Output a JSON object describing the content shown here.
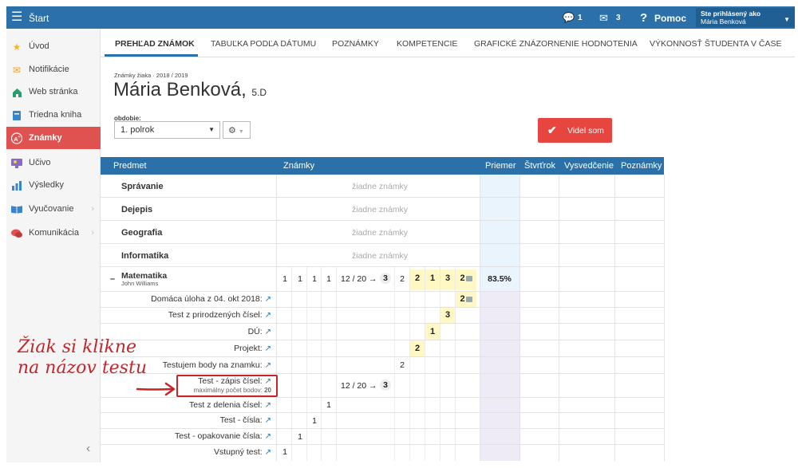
{
  "topbar": {
    "menu_icon": "hamburger-icon",
    "title": "Štart",
    "chat_count": "1",
    "mail_count": "3",
    "help_label": "Pomoc",
    "user_line1": "Ste prihlásený ako",
    "user_line2": "Mária Benková"
  },
  "sidebar": {
    "items": [
      {
        "label": "Úvod",
        "icon": "star-icon",
        "color": "#f2b52a"
      },
      {
        "label": "Notifikácie",
        "icon": "envelope-icon",
        "color": "#f0a030"
      },
      {
        "label": "Web stránka",
        "icon": "home-icon",
        "color": "#2a9d6c"
      },
      {
        "label": "Triedna kniha",
        "icon": "book-icon",
        "color": "#3a85c8"
      },
      {
        "label": "Známky",
        "icon": "grade-icon",
        "color": "#ffffff"
      },
      {
        "label": "Učivo",
        "icon": "lesson-icon",
        "color": "#8a6ac8"
      },
      {
        "label": "Výsledky",
        "icon": "bar-chart-icon",
        "color": "#3a85c8"
      },
      {
        "label": "Vyučovanie",
        "icon": "open-book-icon",
        "color": "#3a85c8"
      },
      {
        "label": "Komunikácia",
        "icon": "chat-icon",
        "color": "#e0524f"
      }
    ]
  },
  "tabs": [
    "PREHĽAD ZNÁMOK",
    "TABUĽKA PODĽA DÁTUMU",
    "POZNÁMKY",
    "KOMPETENCIE",
    "GRAFICKÉ ZNÁZORNENIE HODNOTENIA",
    "VÝKONNOSŤ ŠTUDENTA V ČASE"
  ],
  "header": {
    "subtitle": "Známky žiaka · 2018 / 2019",
    "student_name": "Mária Benková,",
    "student_class": "5.D",
    "period_label": "obdobie:",
    "period_value": "1. polrok",
    "seen_button": "Videl som"
  },
  "grid": {
    "columns": [
      "Predmet",
      "Známky",
      "Priemer",
      "Štvrťrok",
      "Vysvedčenie",
      "Poznámky"
    ],
    "empty_text": "žiadne známky",
    "subjects_empty": [
      "Správanie",
      "Dejepis",
      "Geografia",
      "Informatika"
    ],
    "math": {
      "name": "Matematika",
      "teacher": "John Williams",
      "collapse": "–",
      "grades": [
        "1",
        "1",
        "1",
        "1",
        "12 / 20 →",
        "3",
        "2",
        "2",
        "1",
        "3",
        "2"
      ],
      "average": "83.5%"
    },
    "tests": [
      {
        "label": "Domáca úloha z 04. okt 2018:",
        "grade": "2"
      },
      {
        "label": "Test z prirodzených čísel:",
        "grade": "3"
      },
      {
        "label": "DÚ:",
        "grade": "1"
      },
      {
        "label": "Projekt:",
        "grade": "2"
      },
      {
        "label": "Testujem body na znamku:",
        "grade": "2"
      },
      {
        "label": "Test - zápis čísel:",
        "sublabel": "maximálny počet bodov:",
        "max_points": "20",
        "points": "12 / 20 →",
        "grade": "3"
      },
      {
        "label": "Test z delenia čísel:",
        "grade": "1"
      },
      {
        "label": "Test - čísla:",
        "grade": "1"
      },
      {
        "label": "Test - opakovanie čísla:",
        "grade": "1"
      },
      {
        "label": "Vstupný test:",
        "grade": "1"
      }
    ]
  },
  "annotation": {
    "line1": "Žiak si klikne",
    "line2": "na názov testu"
  }
}
